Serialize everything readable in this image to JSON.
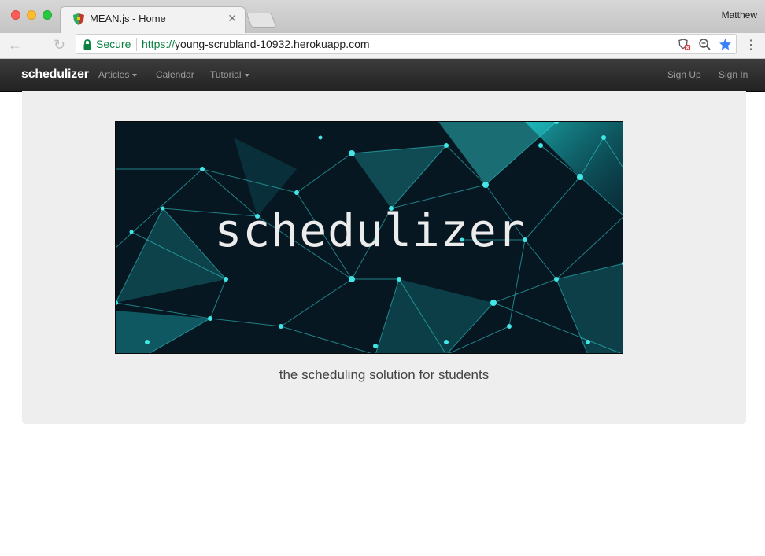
{
  "browser": {
    "tab_title": "MEAN.js - Home",
    "tab_close_icon": "close-icon",
    "profile_name": "Matthew",
    "secure_label": "Secure",
    "url_scheme": "https://",
    "url_host": "young-scrubland-10932.herokuapp.com",
    "icons": [
      "back-arrow-icon",
      "reload-icon",
      "lock-icon",
      "shield-blocked-icon",
      "zoom-icon",
      "star-icon",
      "menu-dots-icon"
    ]
  },
  "navbar": {
    "brand": "schedulizer",
    "items": [
      {
        "label": "Articles",
        "dropdown": true
      },
      {
        "label": "Calendar",
        "dropdown": false
      },
      {
        "label": "Tutorial",
        "dropdown": true
      }
    ],
    "right_items": [
      {
        "label": "Sign Up"
      },
      {
        "label": "Sign In"
      }
    ]
  },
  "hero": {
    "banner_text": "schedulizer",
    "tagline": "the scheduling solution for students"
  },
  "colors": {
    "navbar_bg": "#222222",
    "accent_teal": "#2ee6e6",
    "secure_green": "#0b8043",
    "bookmark_star": "#3b82f6"
  }
}
